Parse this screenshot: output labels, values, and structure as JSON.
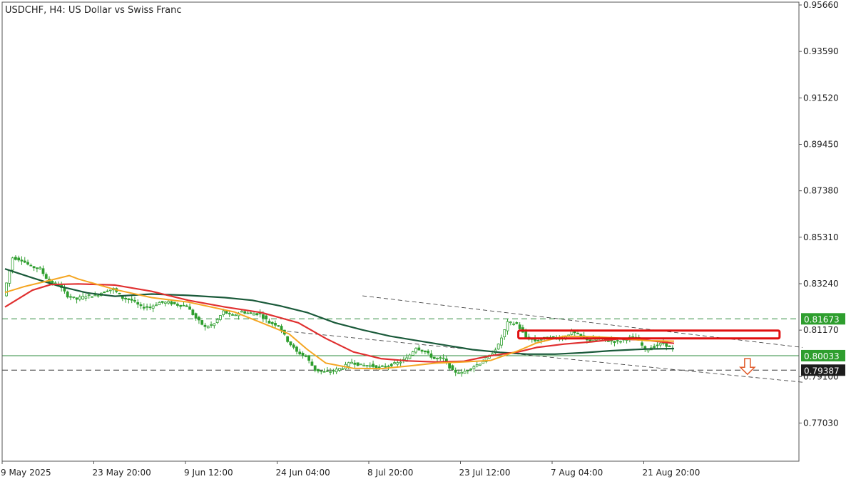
{
  "header": {
    "title": "USDCHF, H4:  US Dollar vs Swiss Franc"
  },
  "colors": {
    "candle": "#2e9e2e",
    "ma_fast": "#f5a623",
    "ma_mid": "#e03030",
    "ma_slow": "#1a5a3a",
    "level_line": "#2e8b3e",
    "price_tag_bg": "#2e9e2e",
    "current_tag_bg": "#1c1c1c",
    "highlight_box": "#e01010",
    "arrow": "#e05a2a",
    "trendline": "#333333"
  },
  "chart_data": {
    "type": "line",
    "symbol": "USDCHF",
    "timeframe": "H4",
    "ylim": [
      0.76,
      0.9566
    ],
    "y_ticks": [
      "0.95660",
      "0.93590",
      "0.91520",
      "0.89450",
      "0.87380",
      "0.85310",
      "0.83240",
      "0.81170",
      "0.79100",
      "0.77030"
    ],
    "x_ticks": [
      "9 May 2025",
      "23 May 20:00",
      "9 Jun 12:00",
      "24 Jun 04:00",
      "8 Jul 20:00",
      "23 Jul 12:00",
      "7 Aug 04:00",
      "21 Aug 20:00"
    ],
    "x_tick_index": [
      0,
      10,
      20,
      30,
      40,
      50,
      60,
      70
    ],
    "bar_count": 86,
    "series": [
      {
        "key": "ma_fast",
        "points": [
          [
            0,
            0.8285
          ],
          [
            2,
            0.831
          ],
          [
            4,
            0.833
          ],
          [
            7,
            0.836
          ],
          [
            8,
            0.8345
          ],
          [
            12,
            0.8298
          ],
          [
            16,
            0.8262
          ],
          [
            20,
            0.8242
          ],
          [
            25,
            0.8198
          ],
          [
            28,
            0.815
          ],
          [
            31,
            0.81
          ],
          [
            33,
            0.803
          ],
          [
            35,
            0.797
          ],
          [
            38,
            0.7947
          ],
          [
            41,
            0.7945
          ],
          [
            44,
            0.7957
          ],
          [
            47,
            0.797
          ],
          [
            50,
            0.7975
          ],
          [
            53,
            0.7982
          ],
          [
            56,
            0.8025
          ],
          [
            58,
            0.806
          ],
          [
            61,
            0.809
          ],
          [
            64,
            0.8088
          ],
          [
            67,
            0.8082
          ],
          [
            70,
            0.807
          ],
          [
            73,
            0.8068
          ]
        ]
      },
      {
        "key": "ma_mid",
        "points": [
          [
            0,
            0.822
          ],
          [
            3,
            0.8295
          ],
          [
            5,
            0.832
          ],
          [
            8,
            0.8323
          ],
          [
            12,
            0.8318
          ],
          [
            16,
            0.829
          ],
          [
            20,
            0.825
          ],
          [
            24,
            0.822
          ],
          [
            28,
            0.8195
          ],
          [
            32,
            0.815
          ],
          [
            35,
            0.808
          ],
          [
            38,
            0.802
          ],
          [
            41,
            0.799
          ],
          [
            44,
            0.798
          ],
          [
            47,
            0.7975
          ],
          [
            50,
            0.7978
          ],
          [
            53,
            0.8003
          ],
          [
            56,
            0.802
          ],
          [
            58,
            0.804
          ],
          [
            61,
            0.8055
          ],
          [
            64,
            0.8065
          ],
          [
            67,
            0.8078
          ],
          [
            70,
            0.8072
          ],
          [
            73,
            0.8058
          ]
        ]
      },
      {
        "key": "ma_slow",
        "points": [
          [
            0,
            0.839
          ],
          [
            3,
            0.835
          ],
          [
            6,
            0.8312
          ],
          [
            9,
            0.8283
          ],
          [
            12,
            0.8268
          ],
          [
            16,
            0.8278
          ],
          [
            20,
            0.8272
          ],
          [
            24,
            0.8262
          ],
          [
            27,
            0.825
          ],
          [
            30,
            0.8225
          ],
          [
            33,
            0.8195
          ],
          [
            36,
            0.815
          ],
          [
            39,
            0.8118
          ],
          [
            42,
            0.809
          ],
          [
            45,
            0.807
          ],
          [
            48,
            0.805
          ],
          [
            51,
            0.803
          ],
          [
            54,
            0.8018
          ],
          [
            57,
            0.801
          ],
          [
            60,
            0.801
          ],
          [
            63,
            0.8016
          ],
          [
            66,
            0.8025
          ],
          [
            70,
            0.8033
          ],
          [
            73,
            0.8035
          ]
        ]
      },
      {
        "key": "price",
        "points": [
          [
            0,
            0.827
          ],
          [
            1,
            0.844
          ],
          [
            2,
            0.843
          ],
          [
            3,
            0.84
          ],
          [
            4,
            0.839
          ],
          [
            5,
            0.833
          ],
          [
            6,
            0.832
          ],
          [
            7,
            0.827
          ],
          [
            8,
            0.8255
          ],
          [
            9,
            0.827
          ],
          [
            10,
            0.827
          ],
          [
            11,
            0.829
          ],
          [
            12,
            0.83
          ],
          [
            13,
            0.826
          ],
          [
            14,
            0.825
          ],
          [
            15,
            0.822
          ],
          [
            16,
            0.822
          ],
          [
            17,
            0.824
          ],
          [
            18,
            0.824
          ],
          [
            19,
            0.823
          ],
          [
            20,
            0.8225
          ],
          [
            21,
            0.817
          ],
          [
            22,
            0.813
          ],
          [
            23,
            0.8145
          ],
          [
            24,
            0.82
          ],
          [
            25,
            0.818
          ],
          [
            26,
            0.82
          ],
          [
            27,
            0.819
          ],
          [
            28,
            0.819
          ],
          [
            29,
            0.815
          ],
          [
            30,
            0.814
          ],
          [
            31,
            0.807
          ],
          [
            32,
            0.802
          ],
          [
            33,
            0.8
          ],
          [
            34,
            0.794
          ],
          [
            35,
            0.793
          ],
          [
            36,
            0.7935
          ],
          [
            37,
            0.795
          ],
          [
            38,
            0.7975
          ],
          [
            39,
            0.796
          ],
          [
            40,
            0.796
          ],
          [
            41,
            0.795
          ],
          [
            42,
            0.796
          ],
          [
            43,
            0.797
          ],
          [
            44,
            0.799
          ],
          [
            45,
            0.804
          ],
          [
            46,
            0.802
          ],
          [
            47,
            0.799
          ],
          [
            48,
            0.799
          ],
          [
            49,
            0.7935
          ],
          [
            50,
            0.7925
          ],
          [
            51,
            0.795
          ],
          [
            52,
            0.797
          ],
          [
            53,
            0.8
          ],
          [
            54,
            0.805
          ],
          [
            55,
            0.815
          ],
          [
            56,
            0.8145
          ],
          [
            57,
            0.8085
          ],
          [
            58,
            0.807
          ],
          [
            59,
            0.808
          ],
          [
            60,
            0.8085
          ],
          [
            61,
            0.808
          ],
          [
            62,
            0.811
          ],
          [
            63,
            0.809
          ],
          [
            64,
            0.807
          ],
          [
            65,
            0.808
          ],
          [
            66,
            0.807
          ],
          [
            67,
            0.8065
          ],
          [
            68,
            0.808
          ],
          [
            69,
            0.8085
          ],
          [
            70,
            0.803
          ],
          [
            71,
            0.8045
          ],
          [
            72,
            0.806
          ],
          [
            73,
            0.803
          ]
        ]
      }
    ],
    "levels": [
      {
        "value": 0.81673,
        "label": "0.81673",
        "style": "dashed",
        "tag": "green"
      },
      {
        "value": 0.80033,
        "label": "0.80033",
        "style": "solid",
        "tag": "green"
      },
      {
        "value": 0.79387,
        "label": "0.79387",
        "style": "dashed",
        "tag": "dark"
      }
    ],
    "trendlines": [
      {
        "from": [
          39,
          0.827
        ],
        "to": [
          87,
          0.804
        ]
      },
      {
        "from": [
          30,
          0.8115
        ],
        "to": [
          87,
          0.7885
        ]
      }
    ],
    "highlight_box": {
      "x_from": 56,
      "x_to": 84.5,
      "y_top": 0.8115,
      "y_bottom": 0.808
    },
    "arrow": {
      "x": 81,
      "y_top": 0.799,
      "y_bottom": 0.792,
      "direction": "down"
    }
  }
}
